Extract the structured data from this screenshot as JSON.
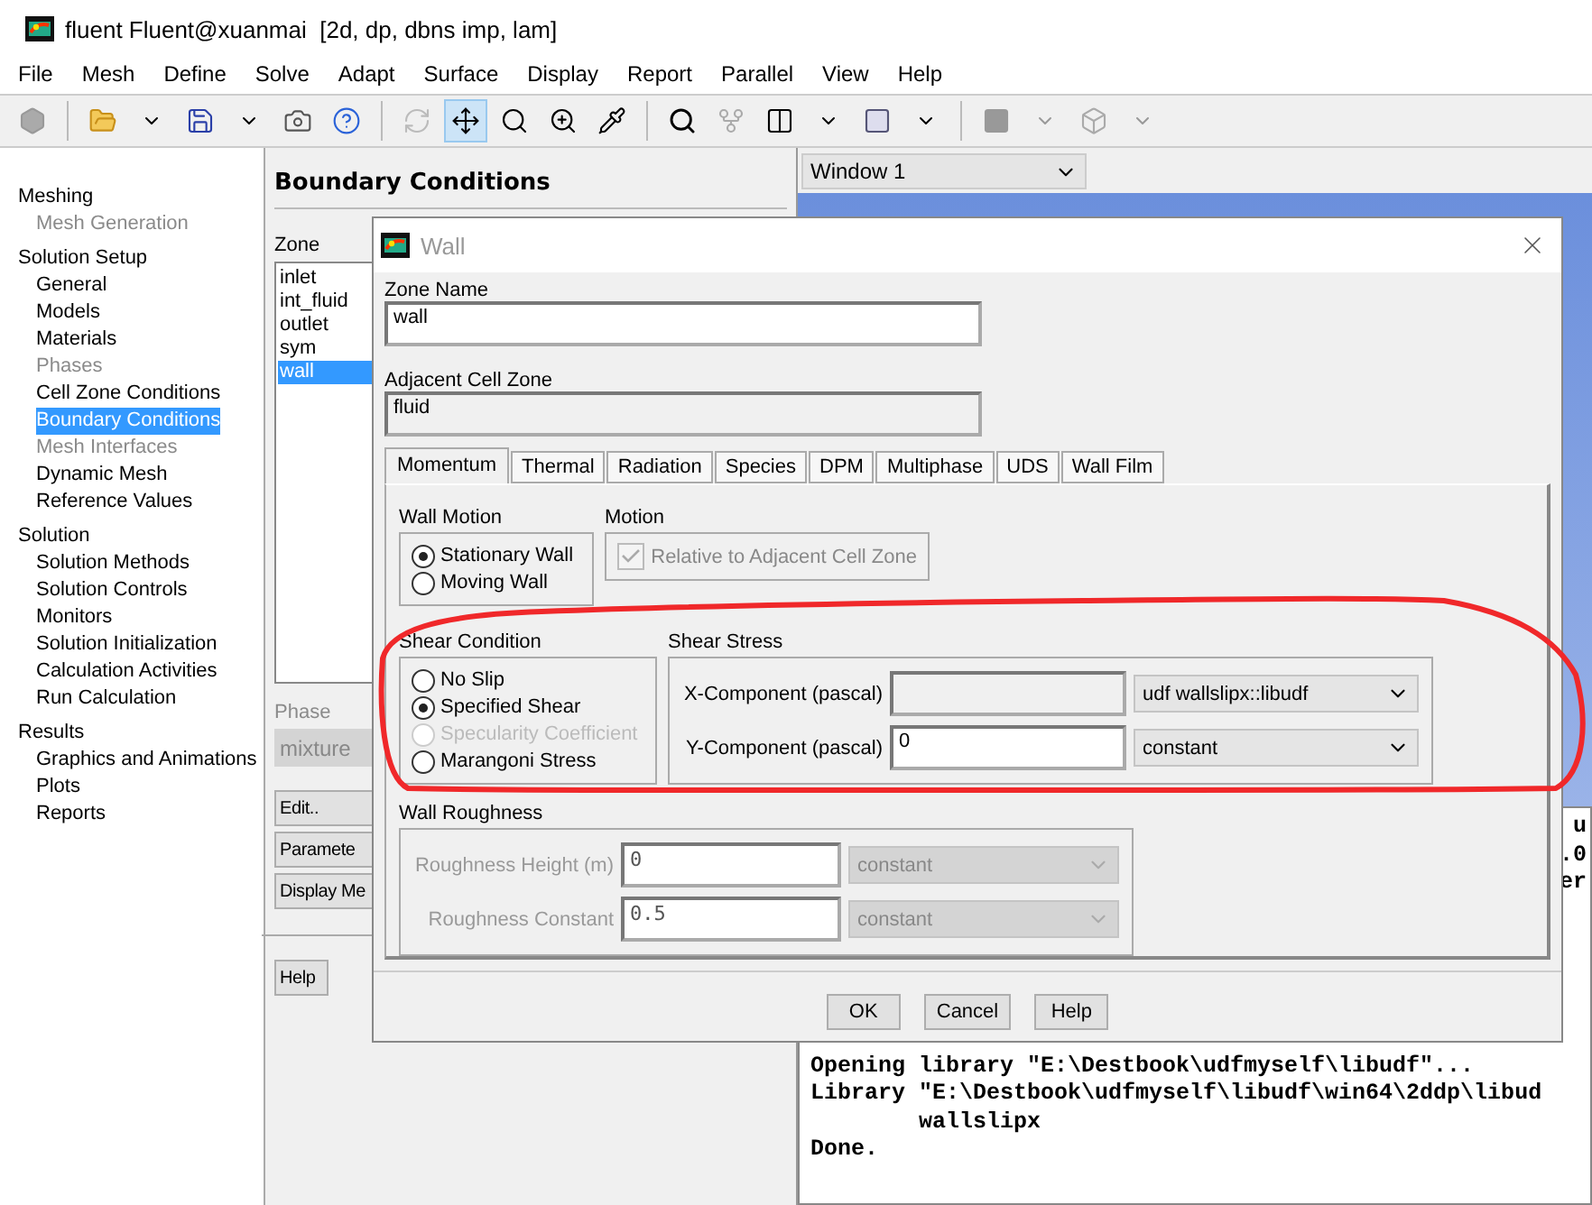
{
  "window": {
    "title": "fluent Fluent@xuanmai  [2d, dp, dbns imp, lam]"
  },
  "menu": [
    "File",
    "Mesh",
    "Define",
    "Solve",
    "Adapt",
    "Surface",
    "Display",
    "Report",
    "Parallel",
    "View",
    "Help"
  ],
  "navigation": {
    "sections": [
      {
        "label": "Meshing",
        "children": [
          {
            "label": "Mesh Generation",
            "disabled": true,
            "selected": false
          }
        ]
      },
      {
        "label": "Solution Setup",
        "children": [
          {
            "label": "General",
            "disabled": false,
            "selected": false
          },
          {
            "label": "Models",
            "disabled": false,
            "selected": false
          },
          {
            "label": "Materials",
            "disabled": false,
            "selected": false
          },
          {
            "label": "Phases",
            "disabled": true,
            "selected": false
          },
          {
            "label": "Cell Zone Conditions",
            "disabled": false,
            "selected": false
          },
          {
            "label": "Boundary Conditions",
            "disabled": false,
            "selected": true
          },
          {
            "label": "Mesh Interfaces",
            "disabled": true,
            "selected": false
          },
          {
            "label": "Dynamic Mesh",
            "disabled": false,
            "selected": false
          },
          {
            "label": "Reference Values",
            "disabled": false,
            "selected": false
          }
        ]
      },
      {
        "label": "Solution",
        "children": [
          {
            "label": "Solution Methods",
            "disabled": false,
            "selected": false
          },
          {
            "label": "Solution Controls",
            "disabled": false,
            "selected": false
          },
          {
            "label": "Monitors",
            "disabled": false,
            "selected": false
          },
          {
            "label": "Solution Initialization",
            "disabled": false,
            "selected": false
          },
          {
            "label": "Calculation Activities",
            "disabled": false,
            "selected": false
          },
          {
            "label": "Run Calculation",
            "disabled": false,
            "selected": false
          }
        ]
      },
      {
        "label": "Results",
        "children": [
          {
            "label": "Graphics and Animations",
            "disabled": false,
            "selected": false
          },
          {
            "label": "Plots",
            "disabled": false,
            "selected": false
          },
          {
            "label": "Reports",
            "disabled": false,
            "selected": false
          }
        ]
      }
    ]
  },
  "boundary_conditions": {
    "title": "Boundary Conditions",
    "zone_label": "Zone",
    "zones": [
      {
        "label": "inlet",
        "selected": false
      },
      {
        "label": "int_fluid",
        "selected": false
      },
      {
        "label": "outlet",
        "selected": false
      },
      {
        "label": "sym",
        "selected": false
      },
      {
        "label": "wall",
        "selected": true
      }
    ],
    "phase": {
      "label": "Phase",
      "value": "mixture",
      "disabled": true
    },
    "buttons": [
      "Edit..",
      "Paramete",
      "Display Me"
    ],
    "help": "Help"
  },
  "graphics": {
    "window_select": "Window 1",
    "console": [
      {
        "kind": "fragment",
        "text": "u"
      },
      {
        "kind": "fragment",
        "text": ".0"
      },
      {
        "kind": "fragment",
        "text": "er"
      },
      {
        "kind": "line",
        "text": "Opening library \"E:\\Destbook\\udfmyself\\libudf\"..."
      },
      {
        "kind": "line",
        "text": "Library \"E:\\Destbook\\udfmyself\\libudf\\win64\\2ddp\\libud"
      },
      {
        "kind": "line",
        "text": "        wallslipx"
      },
      {
        "kind": "line",
        "text": "Done."
      }
    ]
  },
  "dialog": {
    "title": "Wall",
    "zone_name_label": "Zone Name",
    "zone_name": "wall",
    "adjacent_label": "Adjacent Cell Zone",
    "adjacent_zone": "fluid",
    "tabs": [
      {
        "label": "Momentum",
        "selected": true
      },
      {
        "label": "Thermal",
        "selected": false
      },
      {
        "label": "Radiation",
        "selected": false
      },
      {
        "label": "Species",
        "selected": false
      },
      {
        "label": "DPM",
        "selected": false
      },
      {
        "label": "Multiphase",
        "selected": false
      },
      {
        "label": "UDS",
        "selected": false
      },
      {
        "label": "Wall Film",
        "selected": false
      }
    ],
    "wall_motion": {
      "label": "Wall Motion",
      "options": [
        {
          "label": "Stationary Wall",
          "checked": true,
          "disabled": false
        },
        {
          "label": "Moving Wall",
          "checked": false,
          "disabled": false
        }
      ]
    },
    "motion": {
      "label": "Motion",
      "checkbox": {
        "label": "Relative to Adjacent Cell Zone",
        "checked": true,
        "disabled": true
      }
    },
    "shear_condition": {
      "label": "Shear Condition",
      "options": [
        {
          "label": "No Slip",
          "checked": false,
          "disabled": false
        },
        {
          "label": "Specified Shear",
          "checked": true,
          "disabled": false
        },
        {
          "label": "Specularity Coefficient",
          "checked": false,
          "disabled": true
        },
        {
          "label": "Marangoni Stress",
          "checked": false,
          "disabled": false
        }
      ]
    },
    "shear_stress": {
      "label": "Shear Stress",
      "rows": [
        {
          "label": "X-Component (pascal)",
          "value": "",
          "disabled": true,
          "method": "udf wallslipx::libudf"
        },
        {
          "label": "Y-Component (pascal)",
          "value": "0",
          "disabled": false,
          "method": "constant"
        }
      ]
    },
    "wall_roughness": {
      "label": "Wall Roughness",
      "disabled": true,
      "rows": [
        {
          "label": "Roughness Height (m)",
          "value": "0",
          "method": "constant"
        },
        {
          "label": "Roughness Constant",
          "value": "0.5",
          "method": "constant"
        }
      ]
    },
    "buttons": [
      "OK",
      "Cancel",
      "Help"
    ]
  }
}
